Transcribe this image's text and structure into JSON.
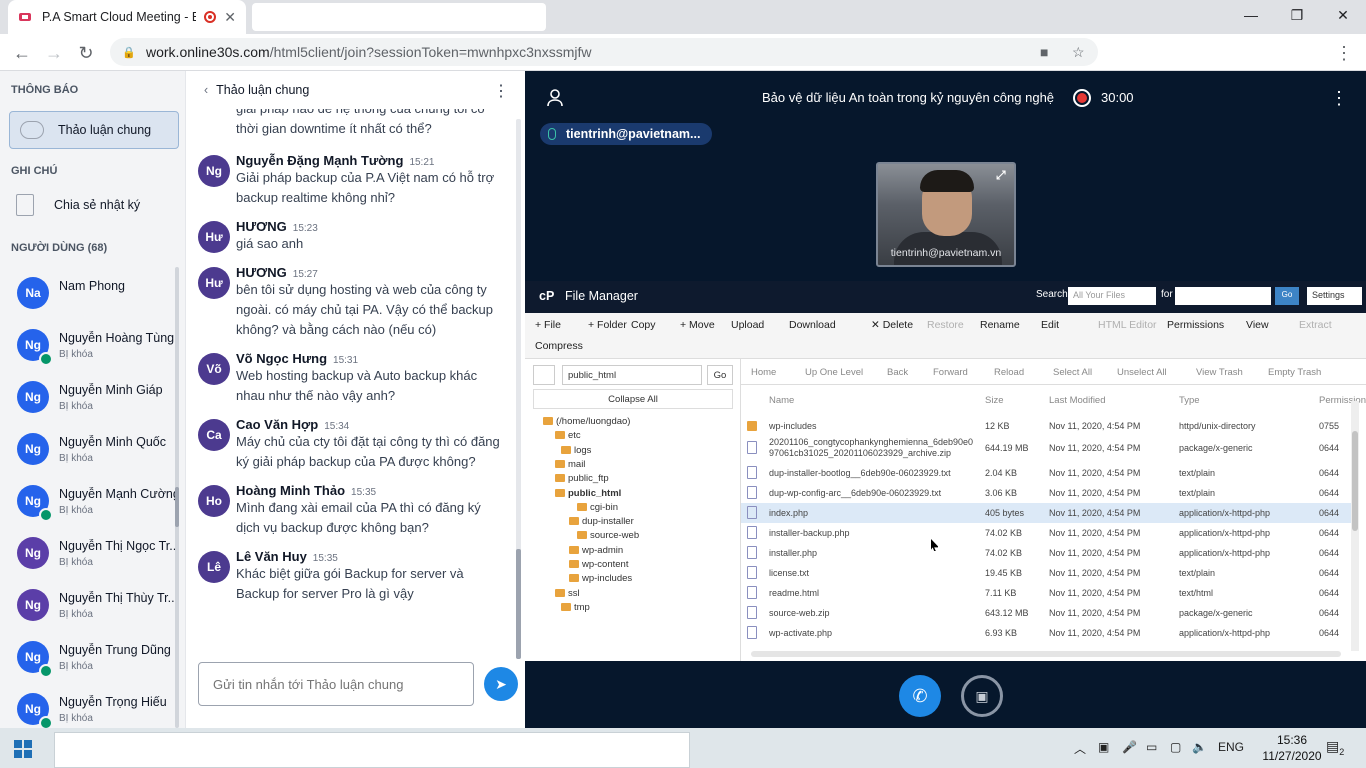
{
  "browser": {
    "tab_title": "P.A Smart Cloud Meeting - B",
    "url_host": "work.online30s.com",
    "url_path": "/html5client/join?sessionToken=mwnhpxc3nxssmjfw"
  },
  "sidebar": {
    "notifications_heading": "THÔNG BÁO",
    "public_chat_label": "Thảo luận chung",
    "notes_heading": "GHI CHÚ",
    "shared_notes_label": "Chia sẻ nhật ký",
    "users_heading": "NGƯỜI DÙNG (68)",
    "users": [
      {
        "initials": "Na",
        "name": "Nam Phong",
        "status": "",
        "color": "#2563eb",
        "online": false
      },
      {
        "initials": "Ng",
        "name": "Nguyễn Hoàng Tùng",
        "status": "BỊ khóa",
        "color": "#2563eb",
        "online": true
      },
      {
        "initials": "Ng",
        "name": "Nguyễn Minh Giáp",
        "status": "BỊ khóa",
        "color": "#2563eb",
        "online": false
      },
      {
        "initials": "Ng",
        "name": "Nguyễn Minh Quốc",
        "status": "BỊ khóa",
        "color": "#2563eb",
        "online": false
      },
      {
        "initials": "Ng",
        "name": "Nguyễn Mạnh Cường",
        "status": "BỊ khóa",
        "color": "#2563eb",
        "online": true
      },
      {
        "initials": "Ng",
        "name": "Nguyễn Thị Ngọc Tr...",
        "status": "BỊ khóa",
        "color": "#5b3ea8",
        "online": false
      },
      {
        "initials": "Ng",
        "name": "Nguyễn Thị Thùy Tr...",
        "status": "BỊ khóa",
        "color": "#5b3ea8",
        "online": false
      },
      {
        "initials": "Ng",
        "name": "Nguyễn Trung Dũng",
        "status": "BỊ khóa",
        "color": "#2563eb",
        "online": true
      },
      {
        "initials": "Ng",
        "name": "Nguyễn Trọng Hiếu",
        "status": "BỊ khóa",
        "color": "#2563eb",
        "online": true
      }
    ]
  },
  "chat": {
    "title": "Thảo luận chung",
    "partial_message": "giải pháp nào để hệ thống của chúng tôi có thời gian downtime ít nhất có thể?",
    "messages": [
      {
        "initials": "Ng",
        "name": "Nguyễn Đặng Mạnh Tường",
        "time": "15:21",
        "text": "Giải pháp backup của P.A Việt nam có hỗ trợ backup realtime không nhỉ?"
      },
      {
        "initials": "Hư",
        "name": "HƯƠNG",
        "time": "15:23",
        "text": "giá sao anh"
      },
      {
        "initials": "Hư",
        "name": "HƯƠNG",
        "time": "15:27",
        "text": "bên tôi sử dụng hosting và web của công ty ngoài. có máy chủ tại PA. Vậy có thể backup không? và bằng cách nào (nếu có)"
      },
      {
        "initials": "Võ",
        "name": "Võ Ngọc Hưng",
        "time": "15:31",
        "text": "Web hosting backup và Auto backup khác nhau như thế nào vậy anh?"
      },
      {
        "initials": "Ca",
        "name": "Cao Văn Hợp",
        "time": "15:34",
        "text": "Máy chủ của cty tôi đặt tại công ty thì có đăng ký giải pháp backup của PA được không?"
      },
      {
        "initials": "Ho",
        "name": "Hoàng Minh Thảo",
        "time": "15:35",
        "text": "Mình đang xài email của PA thì có đăng ký dịch vụ backup được không bạn?"
      },
      {
        "initials": "Lê",
        "name": "Lê Văn Huy",
        "time": "15:35",
        "text": "Khác biệt giữa gói Backup for server và Backup for server Pro là gì vậy"
      }
    ],
    "input_placeholder": "Gửi tin nhắn tới Thảo luận chung"
  },
  "meeting": {
    "title": "Bảo vệ dữ liệu An toàn trong kỷ nguyên công nghệ",
    "timer": "30:00",
    "talker": "tientrinh@pavietnam...",
    "webcam_label": "tientrinh@pavietnam.vn"
  },
  "file_manager": {
    "title": "File Manager",
    "search_label": "Search",
    "search_scope": "All Your Files",
    "for_label": "for",
    "go_label": "Go",
    "settings_label": "Settings",
    "toolbar": [
      "+ File",
      "+ Folder",
      "Copy",
      "+ Move",
      "Upload",
      "Download",
      "✕ Delete",
      "Restore",
      "Rename",
      "Edit",
      "HTML Editor",
      "Permissions",
      "View",
      "Extract",
      "Compress"
    ],
    "path_value": "public_html",
    "collapse_all": "Collapse All",
    "tree": [
      "(/home/luongdao)",
      "etc",
      "logs",
      "mail",
      "public_ftp",
      "public_html",
      "cgi-bin",
      "dup-installer",
      "source-web",
      "wp-admin",
      "wp-content",
      "wp-includes",
      "ssl",
      "tmp"
    ],
    "nav": [
      "Home",
      "Up One Level",
      "Back",
      "Forward",
      "Reload",
      "Select All",
      "Unselect All",
      "View Trash",
      "Empty Trash"
    ],
    "columns": [
      "Name",
      "Size",
      "Last Modified",
      "Type",
      "Permissions"
    ],
    "rows": [
      {
        "name": "wp-includes",
        "size": "12 KB",
        "modified": "Nov 11, 2020, 4:54 PM",
        "type": "httpd/unix-directory",
        "perm": "0755",
        "folder": true
      },
      {
        "name": "20201106_congtycophankynghemienna_6deb90e0 97061cb31025_20201106023929_archive.zip",
        "size": "644.19 MB",
        "modified": "Nov 11, 2020, 4:54 PM",
        "type": "package/x-generic",
        "perm": "0644",
        "folder": false
      },
      {
        "name": "dup-installer-bootlog__6deb90e-06023929.txt",
        "size": "2.04 KB",
        "modified": "Nov 11, 2020, 4:54 PM",
        "type": "text/plain",
        "perm": "0644",
        "folder": false
      },
      {
        "name": "dup-wp-config-arc__6deb90e-06023929.txt",
        "size": "3.06 KB",
        "modified": "Nov 11, 2020, 4:54 PM",
        "type": "text/plain",
        "perm": "0644",
        "folder": false
      },
      {
        "name": "index.php",
        "size": "405 bytes",
        "modified": "Nov 11, 2020, 4:54 PM",
        "type": "application/x-httpd-php",
        "perm": "0644",
        "folder": false
      },
      {
        "name": "installer-backup.php",
        "size": "74.02 KB",
        "modified": "Nov 11, 2020, 4:54 PM",
        "type": "application/x-httpd-php",
        "perm": "0644",
        "folder": false
      },
      {
        "name": "installer.php",
        "size": "74.02 KB",
        "modified": "Nov 11, 2020, 4:54 PM",
        "type": "application/x-httpd-php",
        "perm": "0644",
        "folder": false
      },
      {
        "name": "license.txt",
        "size": "19.45 KB",
        "modified": "Nov 11, 2020, 4:54 PM",
        "type": "text/plain",
        "perm": "0644",
        "folder": false
      },
      {
        "name": "readme.html",
        "size": "7.11 KB",
        "modified": "Nov 11, 2020, 4:54 PM",
        "type": "text/html",
        "perm": "0644",
        "folder": false
      },
      {
        "name": "source-web.zip",
        "size": "643.12 MB",
        "modified": "Nov 11, 2020, 4:54 PM",
        "type": "package/x-generic",
        "perm": "0644",
        "folder": false
      },
      {
        "name": "wp-activate.php",
        "size": "6.93 KB",
        "modified": "Nov 11, 2020, 4:54 PM",
        "type": "application/x-httpd-php",
        "perm": "0644",
        "folder": false
      }
    ]
  },
  "taskbar": {
    "language": "ENG",
    "time": "15:36",
    "date": "11/27/2020",
    "notifications": "2"
  }
}
